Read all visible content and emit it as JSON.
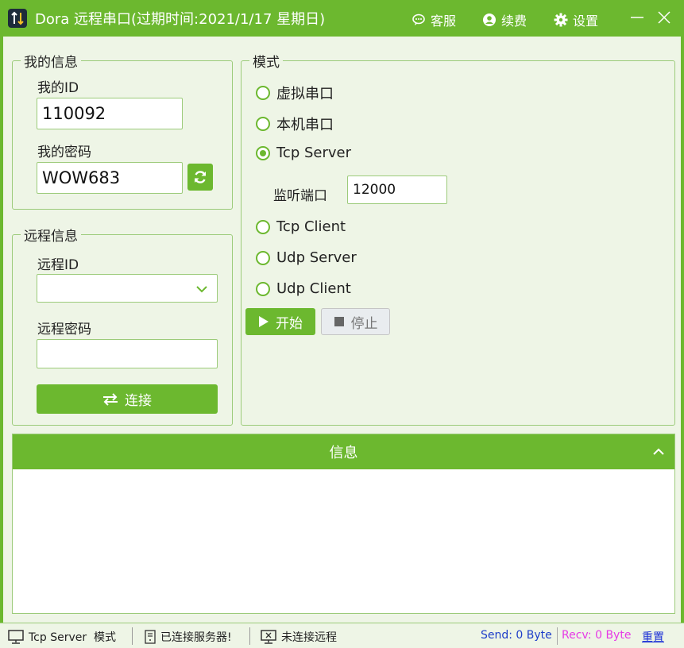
{
  "titlebar": {
    "app_icon_glyph": "⇅",
    "title": "Dora 远程串口(过期时间:2021/1/17 星期日)",
    "service_label": "客服",
    "renew_label": "续费",
    "settings_label": "设置",
    "minimize_symbol": "—",
    "close_symbol": "✕"
  },
  "my_info": {
    "legend": "我的信息",
    "id_label": "我的ID",
    "id_value": "110092",
    "password_label": "我的密码",
    "password_value": "WOW683"
  },
  "remote_info": {
    "legend": "远程信息",
    "id_label": "远程ID",
    "id_value": "",
    "password_label": "远程密码",
    "password_value": "",
    "connect_label": "连接"
  },
  "mode": {
    "legend": "模式",
    "options": [
      {
        "label": "虚拟串口",
        "checked": false
      },
      {
        "label": "本机串口",
        "checked": false
      },
      {
        "label": "Tcp Server",
        "checked": true
      },
      {
        "label": "Tcp Client",
        "checked": false
      },
      {
        "label": "Udp Server",
        "checked": false
      },
      {
        "label": "Udp Client",
        "checked": false
      }
    ],
    "port_label": "监听端口",
    "port_value": "12000",
    "start_label": "开始",
    "stop_label": "停止"
  },
  "info_panel": {
    "title": "信息",
    "collapse_symbol": "^",
    "content": ""
  },
  "statusbar": {
    "mode_text": "Tcp Server  模式",
    "server_status": "已连接服务器!",
    "remote_status": "未连接远程",
    "send_text": "Send: 0 Byte",
    "recv_text": "Recv: 0 Byte",
    "reset_label": "重置"
  },
  "colors": {
    "accent": "#6cb82f",
    "panel_bg": "#eef5e6",
    "send_color": "#1e3ec9",
    "recv_color": "#e63be6",
    "reset_color": "#1a2fd6"
  }
}
